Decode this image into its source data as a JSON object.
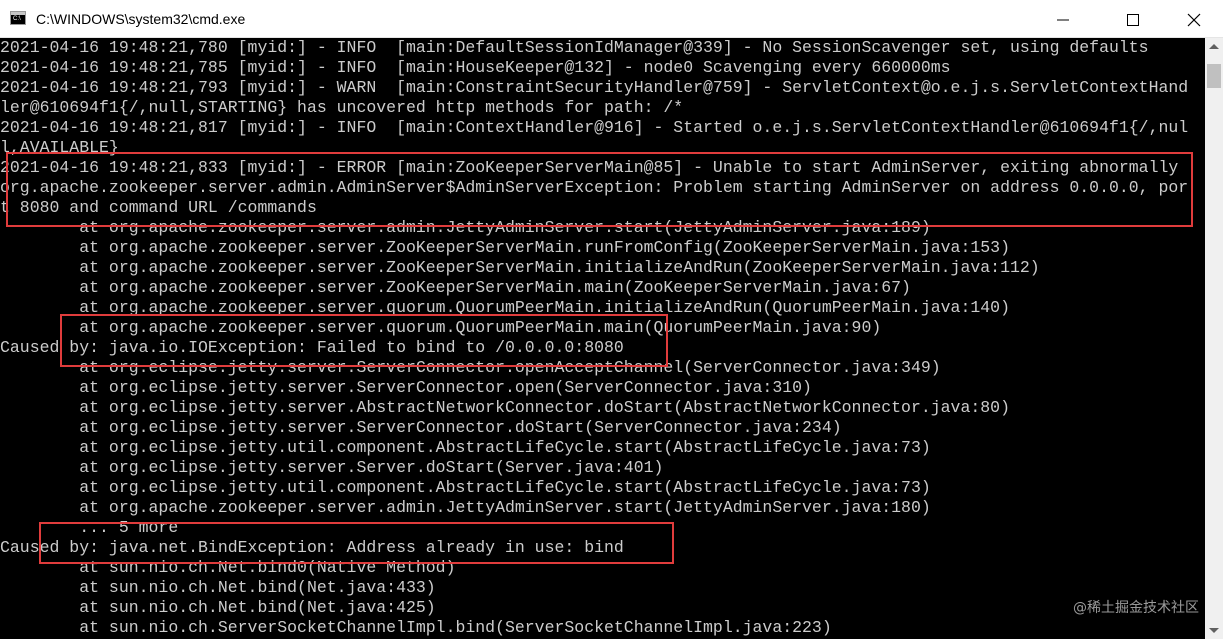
{
  "window": {
    "title": "C:\\WINDOWS\\system32\\cmd.exe",
    "icon": "cmd-icon",
    "icon_text": "C:\\"
  },
  "console": {
    "text_color": "#cccccc",
    "background": "#000000",
    "lines": [
      "2021-04-16 19:48:21,780 [myid:] - INFO  [main:DefaultSessionIdManager@339] - No SessionScavenger set, using defaults",
      "2021-04-16 19:48:21,785 [myid:] - INFO  [main:HouseKeeper@132] - node0 Scavenging every 660000ms",
      "2021-04-16 19:48:21,793 [myid:] - WARN  [main:ConstraintSecurityHandler@759] - ServletContext@o.e.j.s.ServletContextHand",
      "ler@610694f1{/,null,STARTING} has uncovered http methods for path: /*",
      "2021-04-16 19:48:21,817 [myid:] - INFO  [main:ContextHandler@916] - Started o.e.j.s.ServletContextHandler@610694f1{/,nul",
      "l,AVAILABLE}",
      "2021-04-16 19:48:21,833 [myid:] - ERROR [main:ZooKeeperServerMain@85] - Unable to start AdminServer, exiting abnormally",
      "org.apache.zookeeper.server.admin.AdminServer$AdminServerException: Problem starting AdminServer on address 0.0.0.0, por",
      "t 8080 and command URL /commands",
      "        at org.apache.zookeeper.server.admin.JettyAdminServer.start(JettyAdminServer.java:189)",
      "        at org.apache.zookeeper.server.ZooKeeperServerMain.runFromConfig(ZooKeeperServerMain.java:153)",
      "        at org.apache.zookeeper.server.ZooKeeperServerMain.initializeAndRun(ZooKeeperServerMain.java:112)",
      "        at org.apache.zookeeper.server.ZooKeeperServerMain.main(ZooKeeperServerMain.java:67)",
      "        at org.apache.zookeeper.server.quorum.QuorumPeerMain.initializeAndRun(QuorumPeerMain.java:140)",
      "        at org.apache.zookeeper.server.quorum.QuorumPeerMain.main(QuorumPeerMain.java:90)",
      "Caused by: java.io.IOException: Failed to bind to /0.0.0.0:8080",
      "        at org.eclipse.jetty.server.ServerConnector.openAcceptChannel(ServerConnector.java:349)",
      "        at org.eclipse.jetty.server.ServerConnector.open(ServerConnector.java:310)",
      "        at org.eclipse.jetty.server.AbstractNetworkConnector.doStart(AbstractNetworkConnector.java:80)",
      "        at org.eclipse.jetty.server.ServerConnector.doStart(ServerConnector.java:234)",
      "        at org.eclipse.jetty.util.component.AbstractLifeCycle.start(AbstractLifeCycle.java:73)",
      "        at org.eclipse.jetty.server.Server.doStart(Server.java:401)",
      "        at org.eclipse.jetty.util.component.AbstractLifeCycle.start(AbstractLifeCycle.java:73)",
      "        at org.apache.zookeeper.server.admin.JettyAdminServer.start(JettyAdminServer.java:180)",
      "        ... 5 more",
      "Caused by: java.net.BindException: Address already in use: bind",
      "        at sun.nio.ch.Net.bind0(Native Method)",
      "        at sun.nio.ch.Net.bind(Net.java:433)",
      "        at sun.nio.ch.Net.bind(Net.java:425)",
      "        at sun.nio.ch.ServerSocketChannelImpl.bind(ServerSocketChannelImpl.java:223)"
    ]
  },
  "annotations": {
    "box_color": "#e03c3c"
  },
  "watermark": "@稀土掘金技术社区"
}
